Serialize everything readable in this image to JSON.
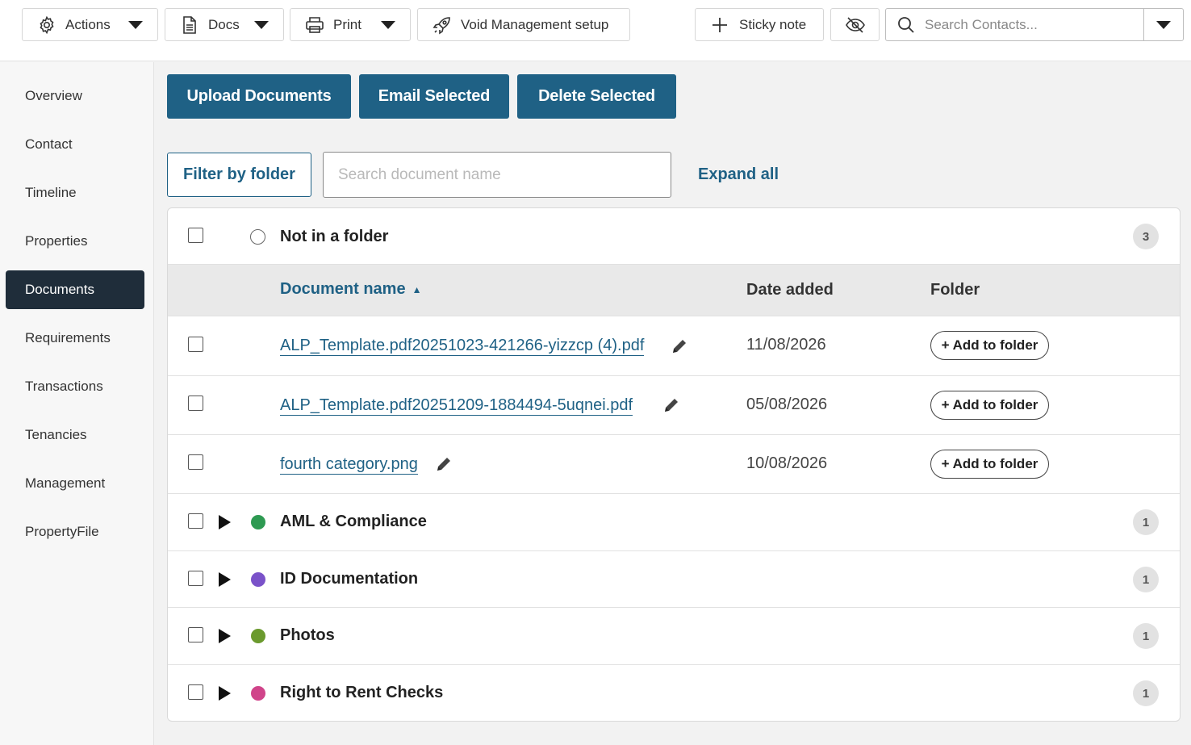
{
  "toolbar": {
    "actions_label": "Actions",
    "docs_label": "Docs",
    "print_label": "Print",
    "void_label": "Void Management setup",
    "sticky_label": "Sticky note",
    "search_placeholder": "Search Contacts..."
  },
  "sidebar": {
    "items": [
      {
        "label": "Overview"
      },
      {
        "label": "Contact"
      },
      {
        "label": "Timeline"
      },
      {
        "label": "Properties"
      },
      {
        "label": "Documents"
      },
      {
        "label": "Requirements"
      },
      {
        "label": "Transactions"
      },
      {
        "label": "Tenancies"
      },
      {
        "label": "Management"
      },
      {
        "label": "PropertyFile"
      }
    ],
    "active": "Documents"
  },
  "actions": {
    "upload": "Upload Documents",
    "email": "Email Selected",
    "delete": "Delete Selected"
  },
  "filter": {
    "filter_label": "Filter by folder",
    "search_placeholder": "Search document name",
    "expand_label": "Expand all"
  },
  "unfoldered": {
    "label": "Not in a folder",
    "count": "3"
  },
  "table": {
    "col_name": "Document name",
    "col_date": "Date added",
    "col_folder": "Folder",
    "add_folder_label": "+ Add to folder",
    "rows": [
      {
        "name": "ALP_Template.pdf20251023-421266-yizzcp (4).pdf",
        "date": "11/08/2026"
      },
      {
        "name": "ALP_Template.pdf20251209-1884494-5uqnei.pdf",
        "date": "05/08/2026"
      },
      {
        "name": "fourth category.png",
        "date": "10/08/2026"
      }
    ]
  },
  "folders": [
    {
      "name": "AML & Compliance",
      "count": "1",
      "color": "#2e9a52"
    },
    {
      "name": "ID Documentation",
      "count": "1",
      "color": "#7a52c9"
    },
    {
      "name": "Photos",
      "count": "1",
      "color": "#6b9a2e"
    },
    {
      "name": "Right to Rent Checks",
      "count": "1",
      "color": "#d0448a"
    }
  ],
  "colors": {
    "primary": "#1f6185",
    "sidebar_active": "#1f2d3a"
  }
}
